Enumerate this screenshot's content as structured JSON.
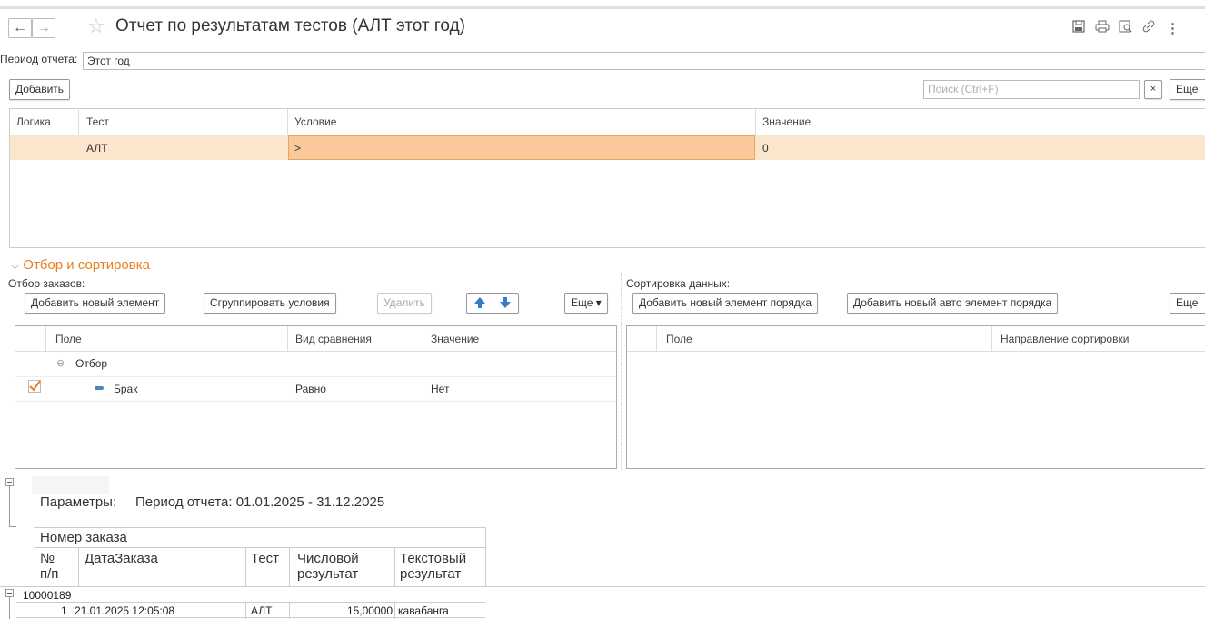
{
  "window": {
    "title": "Отчет по результатам тестов (АЛТ этот год)",
    "back_icon": "←",
    "forward_icon": "→",
    "favorite_icon": "☆",
    "toolbar_icons": [
      "save-icon",
      "print-icon",
      "preview-icon",
      "link-icon",
      "more-icon"
    ]
  },
  "period": {
    "label": "Период отчета:",
    "value": "Этот год"
  },
  "conditions": {
    "add_button": "Добавить",
    "search_placeholder": "Поиск (Ctrl+F)",
    "clear_label": "×",
    "more_button": "Еще",
    "columns": [
      "Логика",
      "Тест",
      "Условие",
      "Значение"
    ],
    "rows": [
      {
        "logic": "",
        "test": "АЛТ",
        "condition": ">",
        "value": "0"
      }
    ]
  },
  "filter_section": {
    "title": "Отбор и сортировка",
    "orders_filter": {
      "label": "Отбор заказов:",
      "buttons": {
        "add": "Добавить новый элемент",
        "group": "Сгруппировать условия",
        "delete": "Удалить",
        "more": "Еще"
      },
      "columns": [
        "Поле",
        "Вид сравнения",
        "Значение"
      ],
      "group_label": "Отбор",
      "rows": [
        {
          "field": "Брак",
          "comparison": "Равно",
          "value": "Нет",
          "checked": true
        }
      ]
    },
    "sorting": {
      "label": "Сортировка данных:",
      "buttons": {
        "add": "Добавить новый элемент порядка",
        "add_auto": "Добавить новый авто элемент порядка",
        "more": "Еще"
      },
      "columns": [
        "Поле",
        "Направление сортировки"
      ]
    }
  },
  "report": {
    "params_label": "Параметры:",
    "params_text": "Период отчета: 01.01.2025 - 31.12.2025",
    "group_header": "Номер заказа",
    "columns": {
      "num": [
        "№",
        "п/п"
      ],
      "date": "ДатаЗаказа",
      "test": "Тест",
      "numeric": [
        "Числовой",
        "результат"
      ],
      "text": [
        "Текстовый",
        "результат"
      ]
    },
    "group_value": "10000189",
    "rows": [
      {
        "num": "1",
        "date": "21.01.2025 12:05:08",
        "test": "АЛТ",
        "numeric": "15,00000",
        "text": "кавабанга"
      }
    ]
  }
}
